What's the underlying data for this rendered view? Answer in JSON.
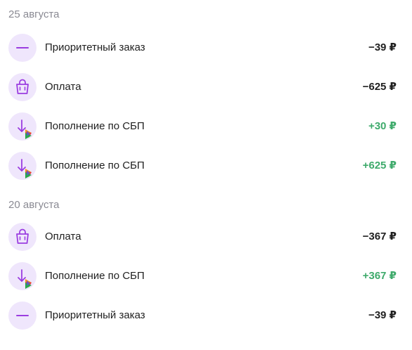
{
  "groups": [
    {
      "date": "25 августа",
      "items": [
        {
          "title": "Приоритетный заказ",
          "amount": "−39 ₽",
          "kind": "expense",
          "icon": "minus-icon"
        },
        {
          "title": "Оплата",
          "amount": "−625 ₽",
          "kind": "expense",
          "icon": "shopping-bag-icon"
        },
        {
          "title": "Пополнение по СБП",
          "amount": "+30 ₽",
          "kind": "income",
          "icon": "sbp-topup-icon"
        },
        {
          "title": "Пополнение по СБП",
          "amount": "+625 ₽",
          "kind": "income",
          "icon": "sbp-topup-icon"
        }
      ]
    },
    {
      "date": "20 августа",
      "items": [
        {
          "title": "Оплата",
          "amount": "−367 ₽",
          "kind": "expense",
          "icon": "shopping-bag-icon"
        },
        {
          "title": "Пополнение по СБП",
          "amount": "+367 ₽",
          "kind": "income",
          "icon": "sbp-topup-icon"
        },
        {
          "title": "Приоритетный заказ",
          "amount": "−39 ₽",
          "kind": "expense",
          "icon": "minus-icon"
        }
      ]
    }
  ],
  "colors": {
    "icon_bg": "#efe6fc",
    "accent": "#9b3de0",
    "income": "#3eaa6b",
    "expense": "#1f1f1f",
    "date": "#8a8a93"
  }
}
